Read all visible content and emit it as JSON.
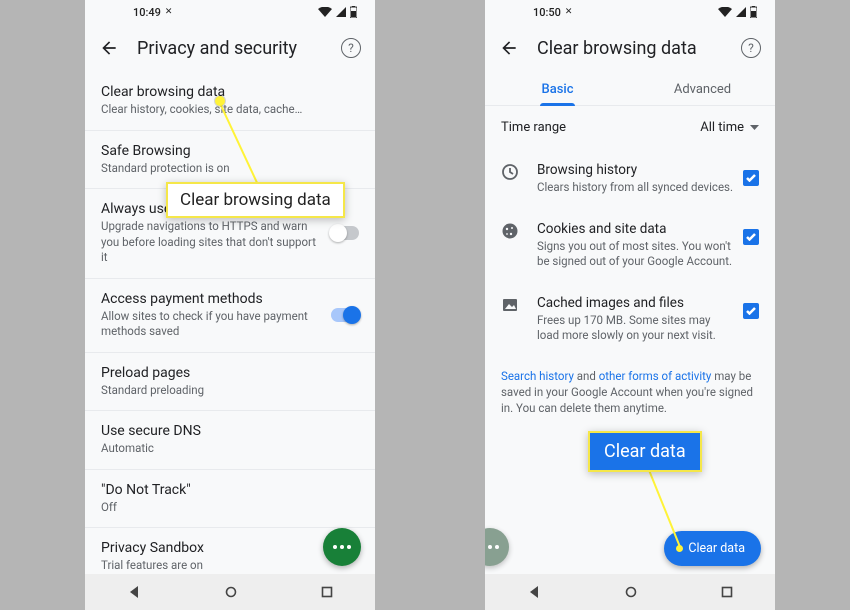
{
  "left": {
    "status": {
      "time": "10:49",
      "time_icon": "●"
    },
    "header": {
      "title": "Privacy and security"
    },
    "rows": [
      {
        "title": "Clear browsing data",
        "sub": "Clear history, cookies, site data, cache…"
      },
      {
        "title": "Safe Browsing",
        "sub": "Standard protection is on"
      },
      {
        "title": "Always use secure connections",
        "sub": "Upgrade navigations to HTTPS and warn you before loading sites that don't support it"
      },
      {
        "title": "Access payment methods",
        "sub": "Allow sites to check if you have payment methods saved"
      },
      {
        "title": "Preload pages",
        "sub": "Standard preloading"
      },
      {
        "title": "Use secure DNS",
        "sub": "Automatic"
      },
      {
        "title": "\"Do Not Track\"",
        "sub": "Off"
      },
      {
        "title": "Privacy Sandbox",
        "sub": "Trial features are on"
      }
    ]
  },
  "right": {
    "status": {
      "time": "10:50",
      "time_icon": "●"
    },
    "header": {
      "title": "Clear browsing data"
    },
    "tabs": {
      "basic": "Basic",
      "advanced": "Advanced"
    },
    "timerange": {
      "label": "Time range",
      "value": "All time"
    },
    "opts": [
      {
        "title": "Browsing history",
        "sub": "Clears history from all synced devices."
      },
      {
        "title": "Cookies and site data",
        "sub": "Signs you out of most sites. You won't be signed out of your Google Account."
      },
      {
        "title": "Cached images and files",
        "sub": "Frees up 170 MB. Some sites may load more slowly on your next visit."
      }
    ],
    "note": {
      "p1": "Search history",
      "p2": " and ",
      "p3": "other forms of activity",
      "p4": " may be saved in your Google Account when you're signed in. You can delete them anytime."
    },
    "clearbtn": "Clear data"
  },
  "callouts": {
    "c1": "Clear browsing data",
    "c2": "Clear data"
  }
}
